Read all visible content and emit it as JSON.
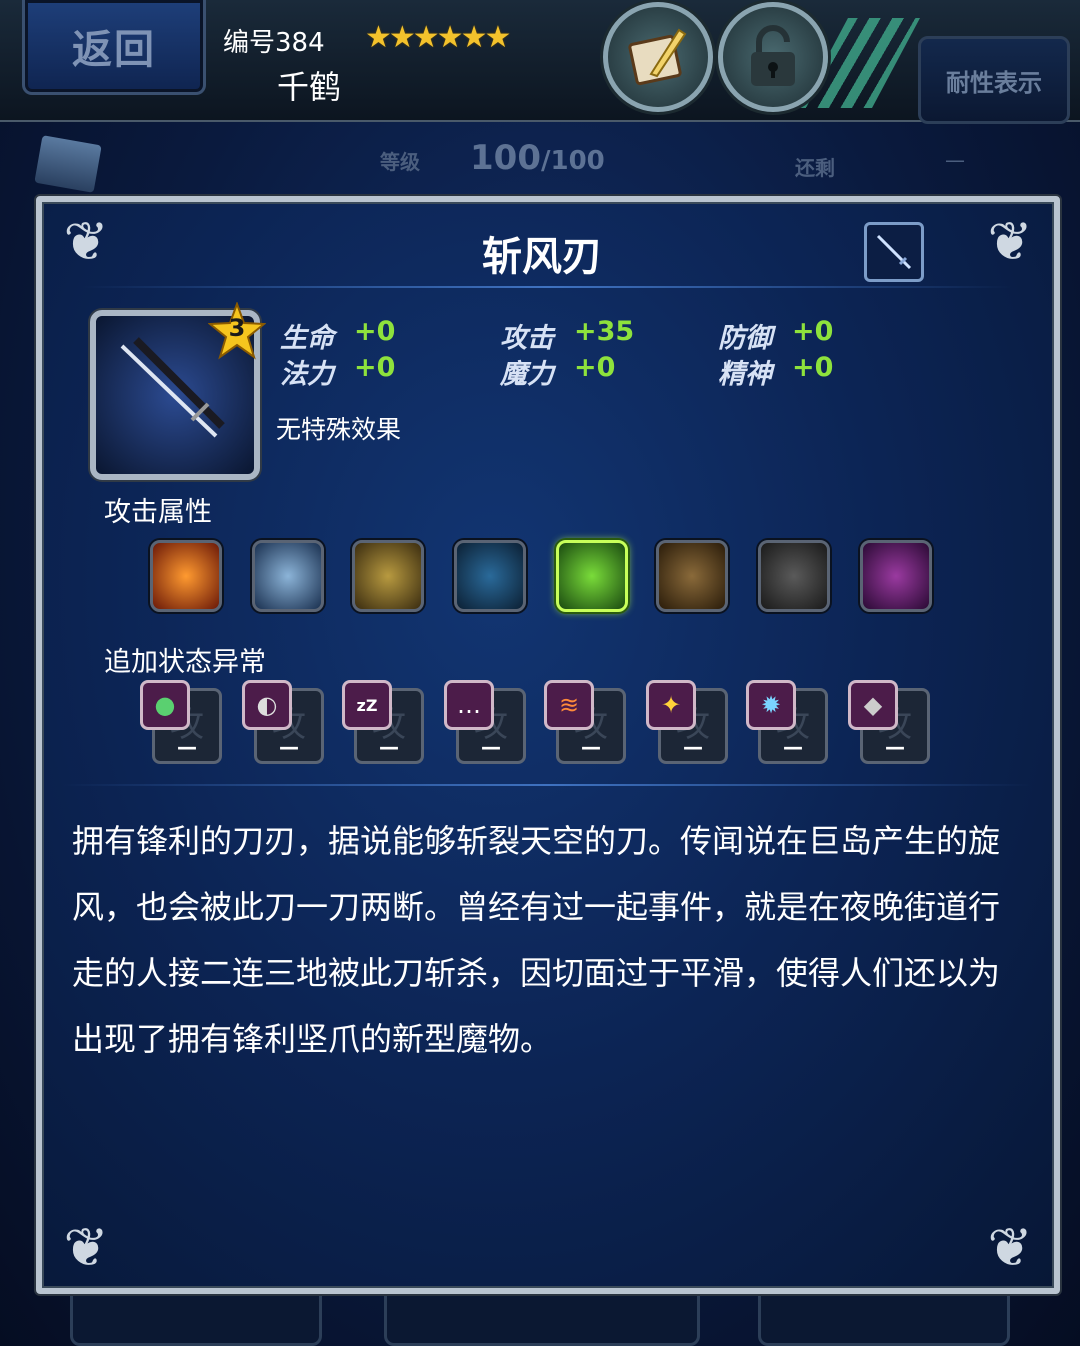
{
  "header": {
    "back_label": "返回",
    "number_label": "编号384",
    "stars": "★★★★★★",
    "unit_name": "千鹤",
    "resistance_label": "耐性表示",
    "book_icon": "quill-book-icon",
    "lock_icon": "padlock-icon"
  },
  "level": {
    "label": "等级",
    "current": "100",
    "max": "/100",
    "remain_label": "还剩",
    "remain_value": "—"
  },
  "item": {
    "name": "斩风刃",
    "rarity": "3",
    "effect": "无特殊效果",
    "stats": [
      {
        "label": "生命",
        "value": "+0"
      },
      {
        "label": "攻击",
        "value": "+35"
      },
      {
        "label": "防御",
        "value": "+0"
      },
      {
        "label": "法力",
        "value": "+0"
      },
      {
        "label": "魔力",
        "value": "+0"
      },
      {
        "label": "精神",
        "value": "+0"
      }
    ],
    "attack_attr_label": "攻击属性",
    "elements": [
      "fire",
      "ice",
      "lightning",
      "water",
      "wind",
      "earth",
      "holy",
      "dark"
    ],
    "active_element": "wind",
    "status_label": "追加状态异常",
    "status_effects": [
      {
        "icon": "poison-icon",
        "value": "—"
      },
      {
        "icon": "blind-icon",
        "value": "—"
      },
      {
        "icon": "sleep-icon",
        "value": "—"
      },
      {
        "icon": "silence-icon",
        "value": "—"
      },
      {
        "icon": "paralysis-icon",
        "value": "—"
      },
      {
        "icon": "confuse-icon",
        "value": "—"
      },
      {
        "icon": "disease-icon",
        "value": "—"
      },
      {
        "icon": "petrify-icon",
        "value": "—"
      }
    ],
    "ghost_char": "攻",
    "description": "拥有锋利的刀刃，据说能够斩裂天空的刀。传闻说在巨岛产生的旋风，也会被此刀一刀两断。曾经有过一起事件，就是在夜晚街道行走的人接二连三地被此刀斩杀，因切面过于平滑，使得人们还以为出现了拥有锋利坚爪的新型魔物。"
  },
  "colors": {
    "stat_value": "#8ee23c",
    "star": "#f3c22c",
    "panel_border": "#b9c4d0"
  }
}
